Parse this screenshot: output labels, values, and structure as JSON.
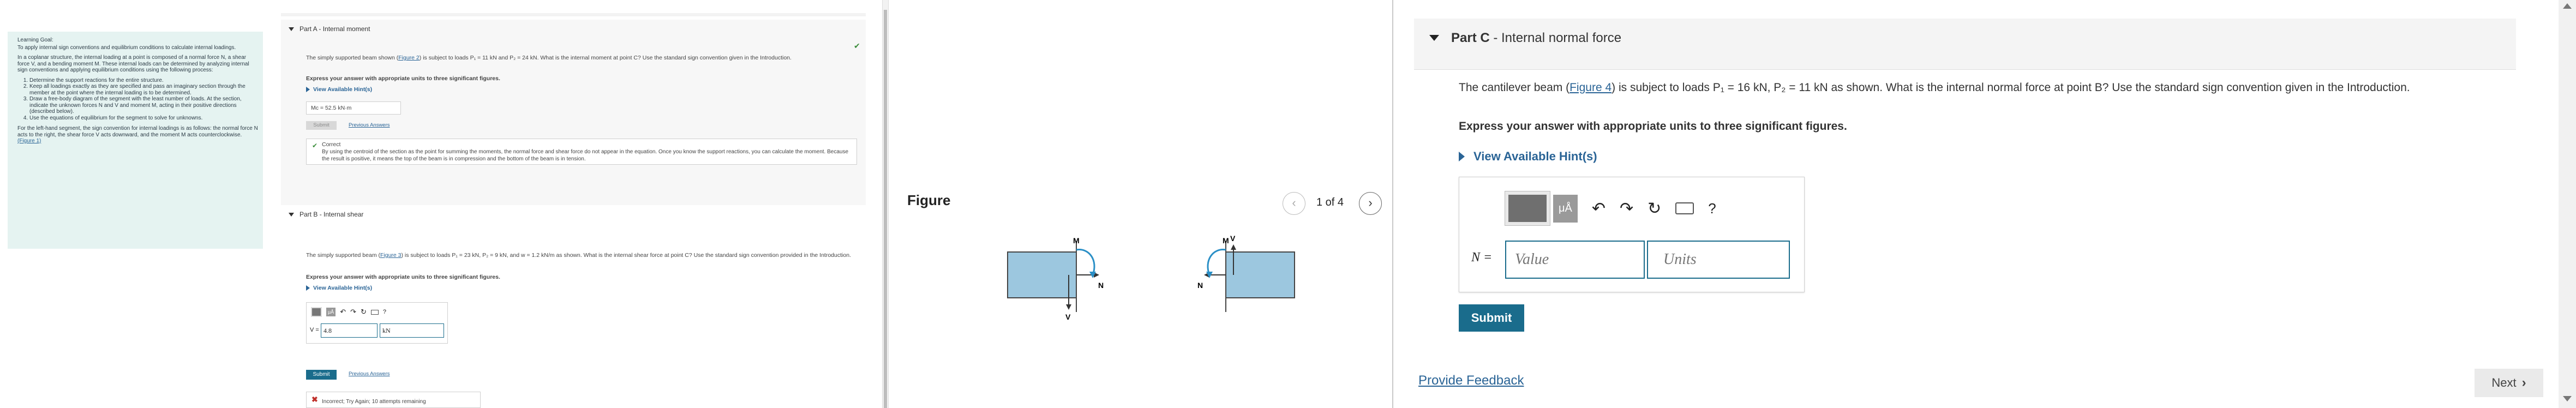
{
  "goal": {
    "heading": "Learning Goal:",
    "p1": "To apply internal sign conventions and equilibrium conditions to calculate internal loadings.",
    "p2": "In a coplanar structure, the internal loading at a point is composed of a normal force N, a shear force V, and a bending moment M. These internal loads can be determined by analyzing internal sign conventions and applying equilibrium conditions using the following process:",
    "steps": [
      "Determine the support reactions for the entire structure.",
      "Keep all loadings exactly as they are specified and pass an imaginary section through the member at the point where the internal loading is to be determined.",
      "Draw a free-body diagram of the segment with the least number of loads. At the section, indicate the unknown forces N and V and moment M, acting in their positive directions (described below).",
      "Use the equations of equilibrium for the segment to solve for unknowns."
    ],
    "p3": "For the left-hand segment, the sign convention for internal loadings is as follows: the normal force N acts to the right, the shear force V acts downward, and the moment M acts counterclockwise.",
    "p3_link": "(Figure 1)"
  },
  "partA": {
    "label": "Part A",
    "sep": " - ",
    "title": "Internal moment",
    "q1": "The simply supported beam shown (",
    "q_link": "Figure 2",
    "q2": ") is subject to loads P₁ = 11 kN and P₂ = 24 kN. What is the internal moment at point C? Use the standard sign convention given in the Introduction.",
    "express": "Express your answer with appropriate units to three significant figures.",
    "hint": "View Available Hint(s)",
    "answer": "Mᴄ = 52.5 kN·m",
    "submit": "Submit",
    "prev": "Previous Answers",
    "correct": "Correct",
    "correct_msg": "By using the centroid of the section as the point for summing the moments, the normal force and shear force do not appear in the equation. Once you know the support reactions, you can calculate the moment. Because the result is positive, it means the top of the beam is in compression and the bottom of the beam is in tension."
  },
  "partB": {
    "label": "Part B",
    "sep": " - ",
    "title": "Internal shear",
    "q1": "The simply supported beam (",
    "q_link": "Figure 3",
    "q2": ") is subject to loads P₁ = 23 kN, P₂ = 9 kN, and w = 1.2 kN/m as shown. What is the internal shear force at point C? Use the standard sign convention provided in the Introduction.",
    "express": "Express your answer with appropriate units to three significant figures.",
    "hint": "View Available Hint(s)",
    "var": "V =",
    "value": "4.8",
    "units": "kN",
    "submit": "Submit",
    "prev": "Previous Answers",
    "incorrect": "Incorrect; Try Again; 10 attempts remaining"
  },
  "figure": {
    "title": "Figure",
    "pager": "1 of 4",
    "M": "M",
    "V": "V",
    "N": "N"
  },
  "partC": {
    "label": "Part C",
    "sep": " - ",
    "title": "Internal normal force",
    "q1": "The cantilever beam (",
    "q_link": "Figure 4",
    "q2": ") is subject to loads P₁ = 16 kN, P₂ = 11 kN as shown. What is the internal normal force at point B? Use the standard sign convention given in the Introduction.",
    "express": "Express your answer with appropriate units to three significant figures.",
    "hint": "View Available Hint(s)",
    "var": "N =",
    "value_placeholder": "Value",
    "units_placeholder": "Units",
    "submit": "Submit",
    "help": "?",
    "mu": "μÅ"
  },
  "feedback": "Provide Feedback",
  "next": "Next",
  "colors": {
    "accent": "#1a6c8c",
    "link": "#2a6496",
    "goal_bg": "#e5f3f1",
    "beam": "#9cc7df"
  }
}
